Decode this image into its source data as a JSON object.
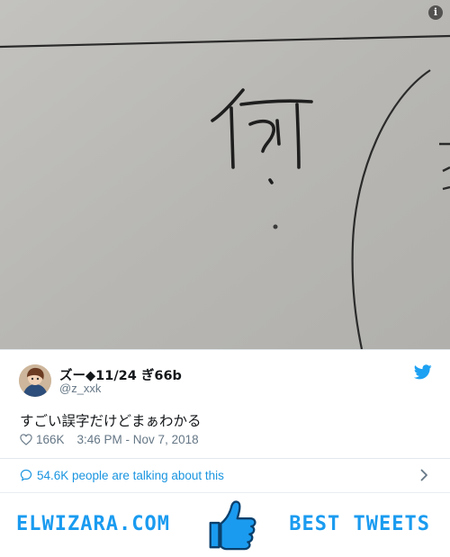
{
  "tweet": {
    "user_name": "ズー◆11/24 ぎ66b",
    "user_handle": "@z_xxk",
    "text": "すごい誤字だけどまぁわかる",
    "like_count": "166K",
    "timestamp": "3:46 PM - Nov 7, 2018",
    "talk_text": "54.6K people are talking about this"
  },
  "icons": {
    "info": "info-icon",
    "bird": "twitter-bird-icon",
    "heart": "heart-icon",
    "chat": "chat-bubble-icon",
    "chevron": "chevron-right-icon",
    "thumb": "thumbs-up-icon"
  },
  "footer": {
    "left_brand": "ELWIZARA.COM",
    "right_brand": "BEST TWEETS"
  },
  "colors": {
    "accent": "#1b95e0",
    "brand": "#1a9bf0",
    "muted": "#657786"
  }
}
